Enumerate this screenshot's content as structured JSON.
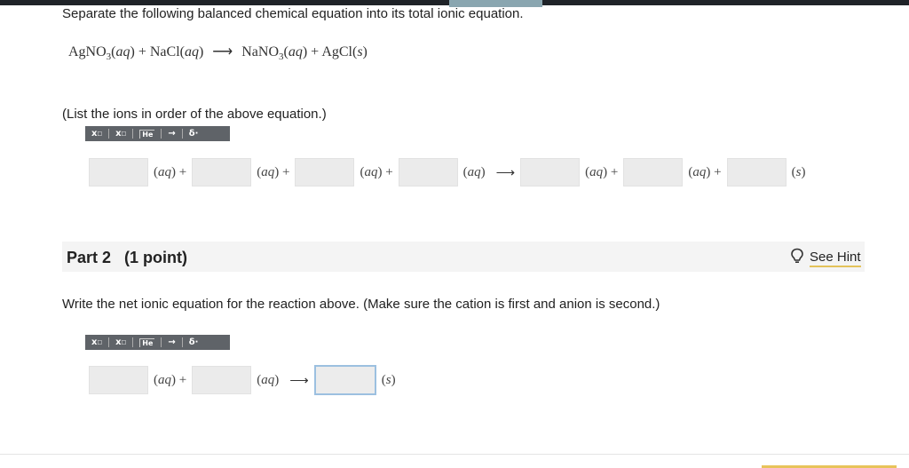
{
  "prompt": "Separate the following balanced chemical equation into its total ionic equation.",
  "equation": {
    "r1": "AgNO",
    "r1_sub": "3",
    "r1_state": "aq",
    "plus1": "+",
    "r2": "NaCl",
    "r2_state": "aq",
    "arrow": "⟶",
    "p1": "NaNO",
    "p1_sub": "3",
    "p1_state": "aq",
    "plus2": "+",
    "p2": "AgCl",
    "p2_state": "s"
  },
  "instruction": "(List the ions in order of the above equation.)",
  "toolbar": {
    "superscript": "x",
    "superscript_mark": "□",
    "subscript": "x",
    "subscript_mark": "□",
    "element": "He",
    "arrow": "→",
    "delta": "δ",
    "delta_mark": "·"
  },
  "part1_row": {
    "aq": "aq",
    "s": "s",
    "plus": "+",
    "arrow": "⟶"
  },
  "part2": {
    "title": "Part 2",
    "points": "(1 point)",
    "hint": "See Hint",
    "question": "Write the net ionic equation for the reaction above. (Make sure the cation is first and anion is second.)"
  },
  "colors": {
    "hint_underline": "#e3c25a",
    "active_box_border": "#9cc0e0"
  }
}
